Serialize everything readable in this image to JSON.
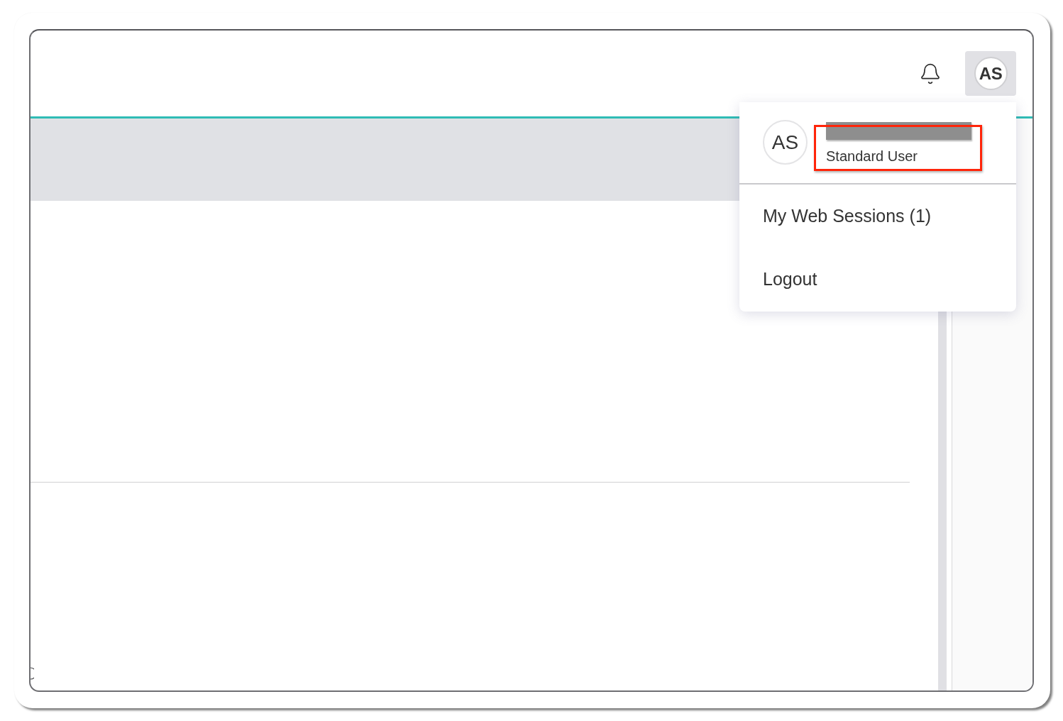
{
  "top_bar": {
    "account_button": {
      "initials": "AS",
      "active": true
    }
  },
  "user_menu": {
    "avatar_initials": "AS",
    "name_redacted": true,
    "role": "Standard User",
    "role_highlighted": true,
    "items": [
      {
        "label": "My Web Sessions (1)"
      },
      {
        "label": "Logout"
      }
    ]
  }
}
